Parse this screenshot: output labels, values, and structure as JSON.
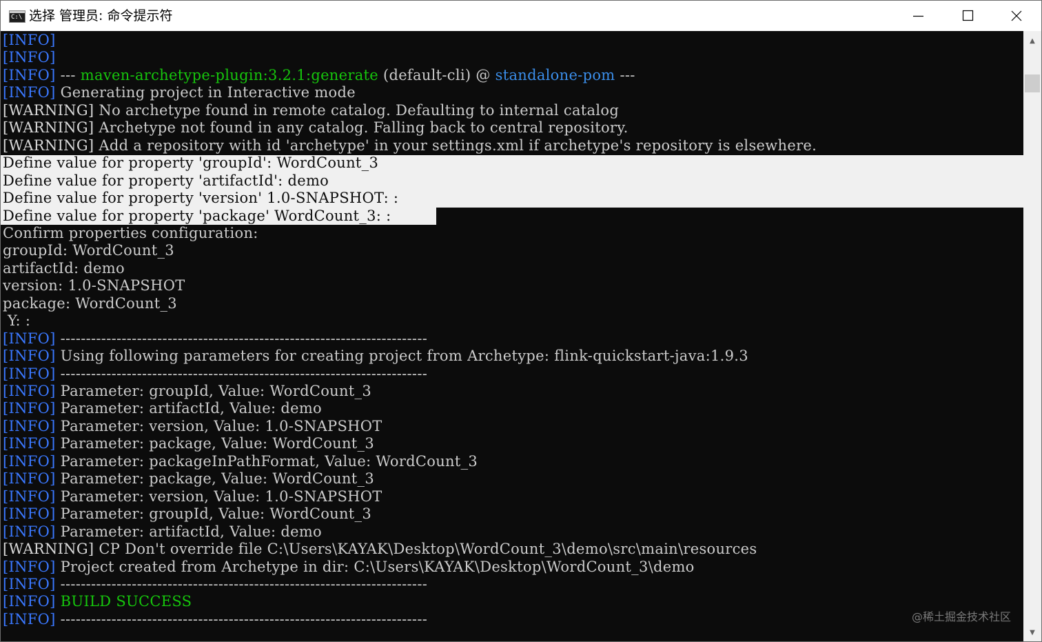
{
  "window": {
    "title": "选择 管理员: 命令提示符",
    "icon": "cmd-icon",
    "icon_text": "C:\\"
  },
  "controls": {
    "minimize": "minimize-icon",
    "maximize": "maximize-icon",
    "close": "close-icon"
  },
  "colors": {
    "console_bg": "#0c0c0c",
    "text": "#cccccc",
    "info_tag": "#3a78ff",
    "green": "#16c60c",
    "blue_link": "#3b8eea",
    "selection_bg": "#f0f0f0"
  },
  "console": {
    "lines": [
      {
        "tag": "[INFO]",
        "text": ""
      },
      {
        "tag": "[INFO]",
        "text": ""
      },
      {
        "tag": "[INFO]",
        "pre": " --- ",
        "plugin": "maven-archetype-plugin:3.2.1:generate",
        "mid": " (default-cli) @ ",
        "project": "standalone-pom",
        "post": " ---"
      },
      {
        "tag": "[INFO]",
        "text": " Generating project in Interactive mode"
      },
      {
        "tag": "[WARNING]",
        "text": " No archetype found in remote catalog. Defaulting to internal catalog"
      },
      {
        "tag": "[WARNING]",
        "text": " Archetype not found in any catalog. Falling back to central repository."
      },
      {
        "tag": "[WARNING]",
        "text": " Add a repository with id 'archetype' in your settings.xml if archetype's repository is elsewhere."
      },
      {
        "text": "Define value for property 'groupId': WordCount_3"
      },
      {
        "text": "Define value for property 'artifactId': demo"
      },
      {
        "text": "Define value for property 'version' 1.0-SNAPSHOT: :"
      },
      {
        "text": "Define value for property 'package' WordCount_3: :"
      },
      {
        "text": "Confirm properties configuration:"
      },
      {
        "text": "groupId: WordCount_3"
      },
      {
        "text": "artifactId: demo"
      },
      {
        "text": "version: 1.0-SNAPSHOT"
      },
      {
        "text": "package: WordCount_3"
      },
      {
        "text": " Y: :"
      },
      {
        "tag": "[INFO]",
        "text": " ------------------------------------------------------------------------"
      },
      {
        "tag": "[INFO]",
        "text": " Using following parameters for creating project from Archetype: flink-quickstart-java:1.9.3"
      },
      {
        "tag": "[INFO]",
        "text": " ------------------------------------------------------------------------"
      },
      {
        "tag": "[INFO]",
        "text": " Parameter: groupId, Value: WordCount_3"
      },
      {
        "tag": "[INFO]",
        "text": " Parameter: artifactId, Value: demo"
      },
      {
        "tag": "[INFO]",
        "text": " Parameter: version, Value: 1.0-SNAPSHOT"
      },
      {
        "tag": "[INFO]",
        "text": " Parameter: package, Value: WordCount_3"
      },
      {
        "tag": "[INFO]",
        "text": " Parameter: packageInPathFormat, Value: WordCount_3"
      },
      {
        "tag": "[INFO]",
        "text": " Parameter: package, Value: WordCount_3"
      },
      {
        "tag": "[INFO]",
        "text": " Parameter: version, Value: 1.0-SNAPSHOT"
      },
      {
        "tag": "[INFO]",
        "text": " Parameter: groupId, Value: WordCount_3"
      },
      {
        "tag": "[INFO]",
        "text": " Parameter: artifactId, Value: demo"
      },
      {
        "tag": "[WARNING]",
        "text": " CP Don't override file C:\\Users\\KAYAK\\Desktop\\WordCount_3\\demo\\src\\main\\resources"
      },
      {
        "tag": "[INFO]",
        "text": " Project created from Archetype in dir: C:\\Users\\KAYAK\\Desktop\\WordCount_3\\demo"
      },
      {
        "tag": "[INFO]",
        "text": " ------------------------------------------------------------------------"
      },
      {
        "tag": "[INFO]",
        "green": " BUILD SUCCESS"
      },
      {
        "tag": "[INFO]",
        "text": " ------------------------------------------------------------------------"
      }
    ]
  },
  "watermark": "@稀土掘金技术社区"
}
